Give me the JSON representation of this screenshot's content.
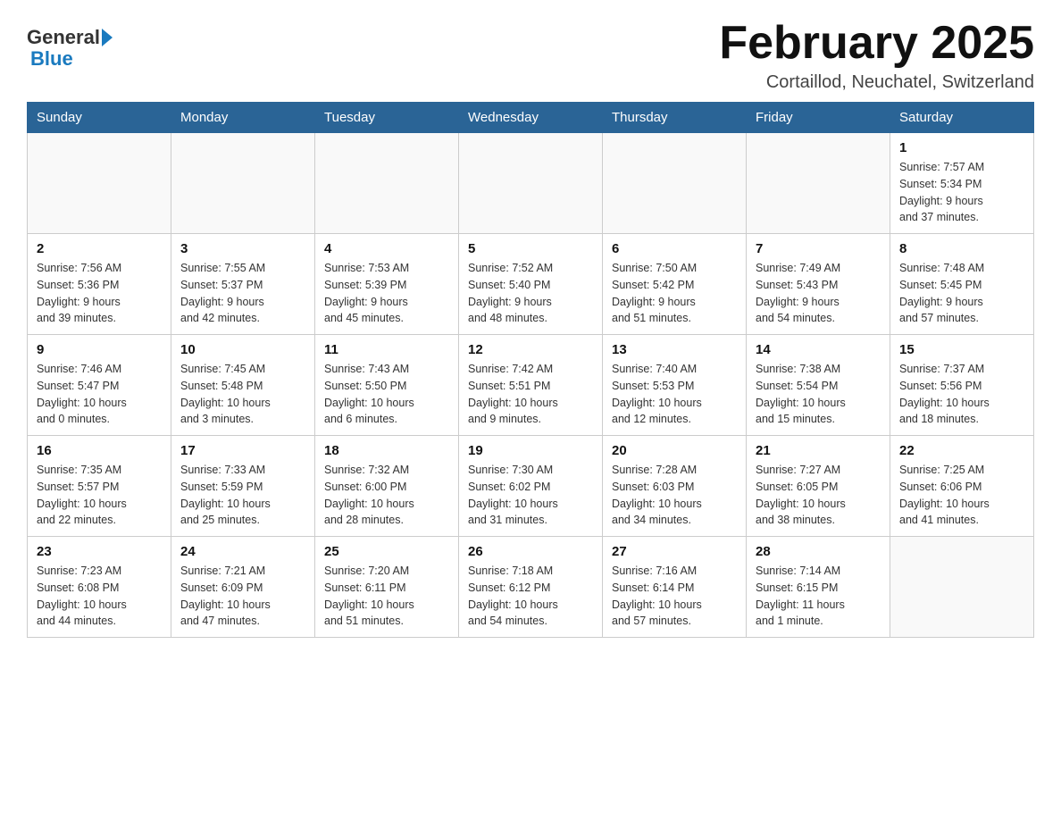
{
  "header": {
    "logo_text_general": "General",
    "logo_text_blue": "Blue",
    "month_title": "February 2025",
    "location": "Cortaillod, Neuchatel, Switzerland"
  },
  "weekdays": [
    "Sunday",
    "Monday",
    "Tuesday",
    "Wednesday",
    "Thursday",
    "Friday",
    "Saturday"
  ],
  "weeks": [
    [
      {
        "day": "",
        "info": ""
      },
      {
        "day": "",
        "info": ""
      },
      {
        "day": "",
        "info": ""
      },
      {
        "day": "",
        "info": ""
      },
      {
        "day": "",
        "info": ""
      },
      {
        "day": "",
        "info": ""
      },
      {
        "day": "1",
        "info": "Sunrise: 7:57 AM\nSunset: 5:34 PM\nDaylight: 9 hours\nand 37 minutes."
      }
    ],
    [
      {
        "day": "2",
        "info": "Sunrise: 7:56 AM\nSunset: 5:36 PM\nDaylight: 9 hours\nand 39 minutes."
      },
      {
        "day": "3",
        "info": "Sunrise: 7:55 AM\nSunset: 5:37 PM\nDaylight: 9 hours\nand 42 minutes."
      },
      {
        "day": "4",
        "info": "Sunrise: 7:53 AM\nSunset: 5:39 PM\nDaylight: 9 hours\nand 45 minutes."
      },
      {
        "day": "5",
        "info": "Sunrise: 7:52 AM\nSunset: 5:40 PM\nDaylight: 9 hours\nand 48 minutes."
      },
      {
        "day": "6",
        "info": "Sunrise: 7:50 AM\nSunset: 5:42 PM\nDaylight: 9 hours\nand 51 minutes."
      },
      {
        "day": "7",
        "info": "Sunrise: 7:49 AM\nSunset: 5:43 PM\nDaylight: 9 hours\nand 54 minutes."
      },
      {
        "day": "8",
        "info": "Sunrise: 7:48 AM\nSunset: 5:45 PM\nDaylight: 9 hours\nand 57 minutes."
      }
    ],
    [
      {
        "day": "9",
        "info": "Sunrise: 7:46 AM\nSunset: 5:47 PM\nDaylight: 10 hours\nand 0 minutes."
      },
      {
        "day": "10",
        "info": "Sunrise: 7:45 AM\nSunset: 5:48 PM\nDaylight: 10 hours\nand 3 minutes."
      },
      {
        "day": "11",
        "info": "Sunrise: 7:43 AM\nSunset: 5:50 PM\nDaylight: 10 hours\nand 6 minutes."
      },
      {
        "day": "12",
        "info": "Sunrise: 7:42 AM\nSunset: 5:51 PM\nDaylight: 10 hours\nand 9 minutes."
      },
      {
        "day": "13",
        "info": "Sunrise: 7:40 AM\nSunset: 5:53 PM\nDaylight: 10 hours\nand 12 minutes."
      },
      {
        "day": "14",
        "info": "Sunrise: 7:38 AM\nSunset: 5:54 PM\nDaylight: 10 hours\nand 15 minutes."
      },
      {
        "day": "15",
        "info": "Sunrise: 7:37 AM\nSunset: 5:56 PM\nDaylight: 10 hours\nand 18 minutes."
      }
    ],
    [
      {
        "day": "16",
        "info": "Sunrise: 7:35 AM\nSunset: 5:57 PM\nDaylight: 10 hours\nand 22 minutes."
      },
      {
        "day": "17",
        "info": "Sunrise: 7:33 AM\nSunset: 5:59 PM\nDaylight: 10 hours\nand 25 minutes."
      },
      {
        "day": "18",
        "info": "Sunrise: 7:32 AM\nSunset: 6:00 PM\nDaylight: 10 hours\nand 28 minutes."
      },
      {
        "day": "19",
        "info": "Sunrise: 7:30 AM\nSunset: 6:02 PM\nDaylight: 10 hours\nand 31 minutes."
      },
      {
        "day": "20",
        "info": "Sunrise: 7:28 AM\nSunset: 6:03 PM\nDaylight: 10 hours\nand 34 minutes."
      },
      {
        "day": "21",
        "info": "Sunrise: 7:27 AM\nSunset: 6:05 PM\nDaylight: 10 hours\nand 38 minutes."
      },
      {
        "day": "22",
        "info": "Sunrise: 7:25 AM\nSunset: 6:06 PM\nDaylight: 10 hours\nand 41 minutes."
      }
    ],
    [
      {
        "day": "23",
        "info": "Sunrise: 7:23 AM\nSunset: 6:08 PM\nDaylight: 10 hours\nand 44 minutes."
      },
      {
        "day": "24",
        "info": "Sunrise: 7:21 AM\nSunset: 6:09 PM\nDaylight: 10 hours\nand 47 minutes."
      },
      {
        "day": "25",
        "info": "Sunrise: 7:20 AM\nSunset: 6:11 PM\nDaylight: 10 hours\nand 51 minutes."
      },
      {
        "day": "26",
        "info": "Sunrise: 7:18 AM\nSunset: 6:12 PM\nDaylight: 10 hours\nand 54 minutes."
      },
      {
        "day": "27",
        "info": "Sunrise: 7:16 AM\nSunset: 6:14 PM\nDaylight: 10 hours\nand 57 minutes."
      },
      {
        "day": "28",
        "info": "Sunrise: 7:14 AM\nSunset: 6:15 PM\nDaylight: 11 hours\nand 1 minute."
      },
      {
        "day": "",
        "info": ""
      }
    ]
  ]
}
